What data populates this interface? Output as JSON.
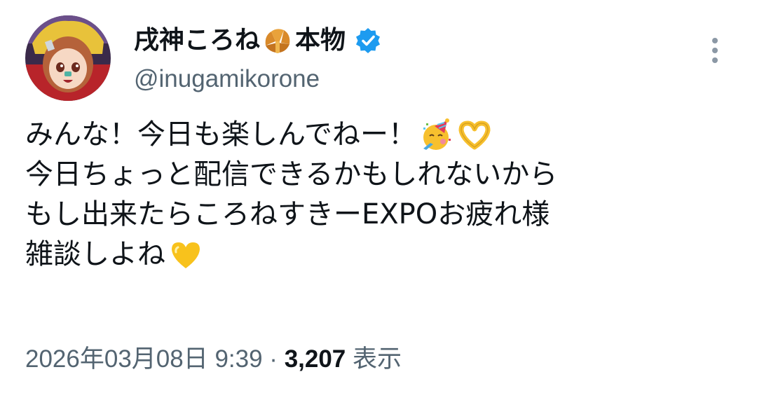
{
  "author": {
    "name_part1": "戌神ころね",
    "name_part2": "本物",
    "handle": "@inugamikorone",
    "verified": true,
    "verified_color": "#1d9bf0"
  },
  "tweet": {
    "lines": [
      "みんな！今日も楽しんでねー！",
      "今日ちょっと配信できるかもしれないから",
      "もし出来たらころねすきーEXPOお疲れ様",
      "雑談しよね"
    ],
    "emojis": [
      "partying-face",
      "heart-hands",
      "croissant",
      "yellow-heart"
    ]
  },
  "meta": {
    "timestamp": "2026年03月08日 9:39",
    "separator": " · ",
    "views_count": "3,207",
    "views_label": " 表示"
  },
  "icons": {
    "more": "more-vertical-icon",
    "verified": "verified-badge-icon"
  }
}
